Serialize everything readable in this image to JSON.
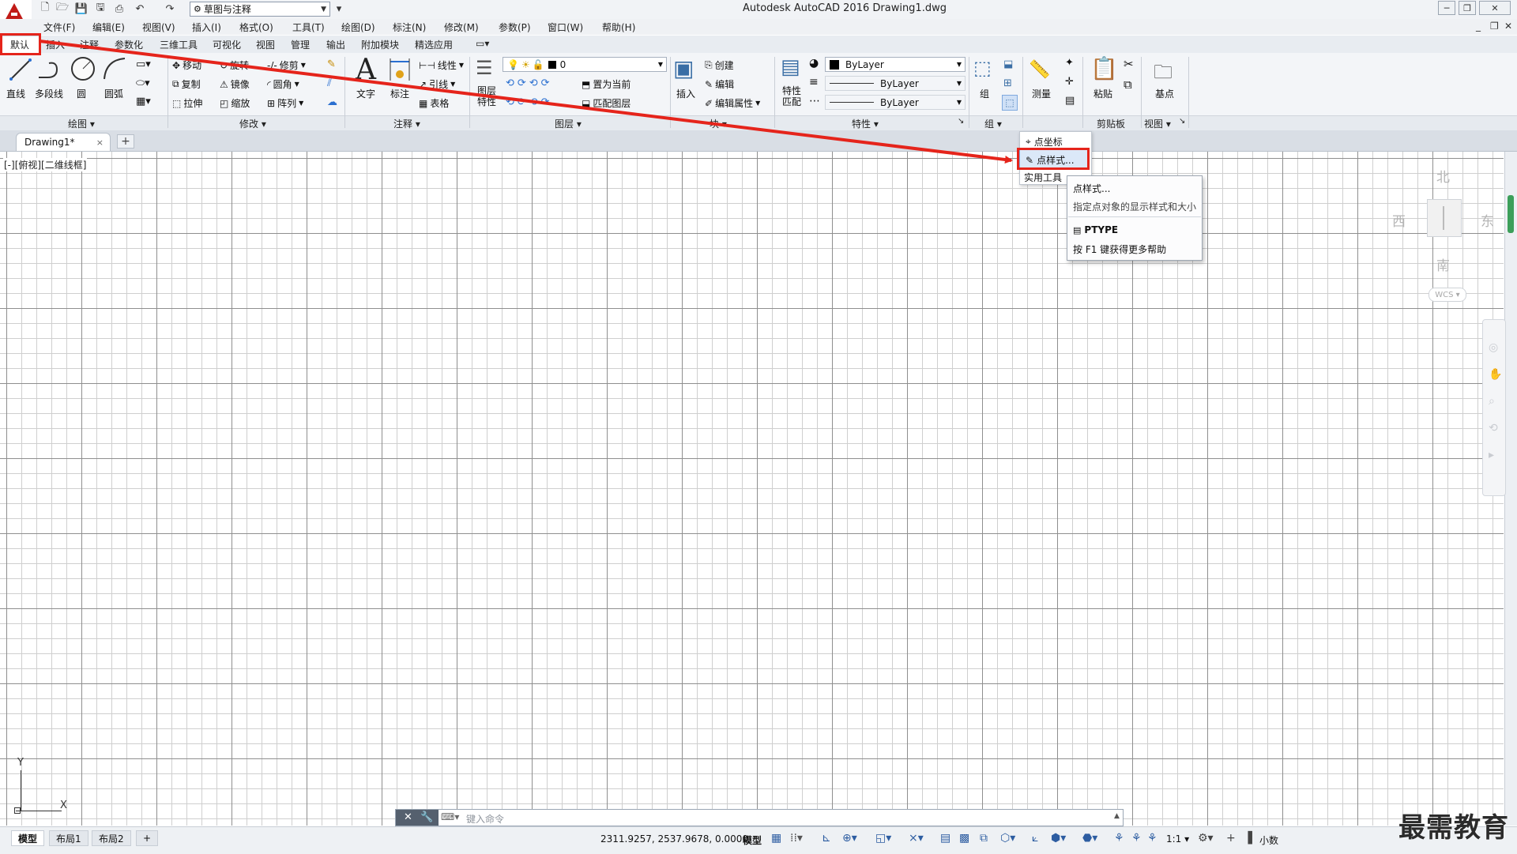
{
  "titlebar": {
    "title": "Autodesk AutoCAD 2016    Drawing1.dwg",
    "workspace": "草图与注释"
  },
  "menus": [
    "文件(F)",
    "编辑(E)",
    "视图(V)",
    "插入(I)",
    "格式(O)",
    "工具(T)",
    "绘图(D)",
    "标注(N)",
    "修改(M)",
    "参数(P)",
    "窗口(W)",
    "帮助(H)"
  ],
  "ribbon_tabs": [
    "默认",
    "插入",
    "注释",
    "参数化",
    "三维工具",
    "可视化",
    "视图",
    "管理",
    "输出",
    "附加模块",
    "精选应用"
  ],
  "ribbon": {
    "draw": {
      "title": "绘图",
      "line": "直线",
      "polyline": "多段线",
      "circle": "圆",
      "arc": "圆弧"
    },
    "modify": {
      "title": "修改",
      "move": "移动",
      "rotate": "旋转",
      "trim": "修剪",
      "copy": "复制",
      "mirror": "镜像",
      "fillet": "圆角",
      "stretch": "拉伸",
      "scale": "缩放",
      "array": "阵列"
    },
    "annotation": {
      "title": "注释",
      "text": "文字",
      "dimension": "标注",
      "linear": "线性",
      "leader": "引线",
      "table": "表格"
    },
    "layers": {
      "title": "图层",
      "props": "图层\n特性",
      "layer_value": "0",
      "make_current": "置为当前",
      "match_layer": "匹配图层"
    },
    "block": {
      "title": "块",
      "insert": "插入",
      "create": "创建",
      "edit": "编辑",
      "edit_attr": "编辑属性"
    },
    "properties": {
      "title": "特性",
      "match": "特性\n匹配",
      "color": "ByLayer",
      "linetype": "ByLayer",
      "lineweight": "ByLayer"
    },
    "groups": {
      "title": "组",
      "group": "组"
    },
    "utilities": {
      "measure": "测量"
    },
    "clipboard": {
      "title": "剪贴板",
      "paste": "粘贴"
    },
    "view": {
      "title": "视图",
      "base": "基点"
    }
  },
  "doc_tab": {
    "name": "Drawing1*",
    "close": "×",
    "new": "+"
  },
  "viewport_label": "[-][俯视][二维线框]",
  "viewcube": {
    "north": "北",
    "south": "南",
    "east": "东",
    "west": "西",
    "wcs": "WCS"
  },
  "ucs": {
    "x": "X",
    "y": "Y"
  },
  "dropdown": {
    "items": [
      "点坐标",
      "点样式...",
      "实用工具"
    ]
  },
  "tooltip": {
    "title": "点样式...",
    "desc": "指定点对象的显示样式和大小",
    "command": "PTYPE",
    "help": "按 F1 键获得更多帮助"
  },
  "command_line": {
    "placeholder": "键入命令"
  },
  "layout_tabs": [
    "模型",
    "布局1",
    "布局2"
  ],
  "status": {
    "coords": "2311.9257, 2537.9678, 0.0000",
    "mode": "模型",
    "scale": "1:1",
    "units": "小数"
  },
  "watermark": "最需教育"
}
